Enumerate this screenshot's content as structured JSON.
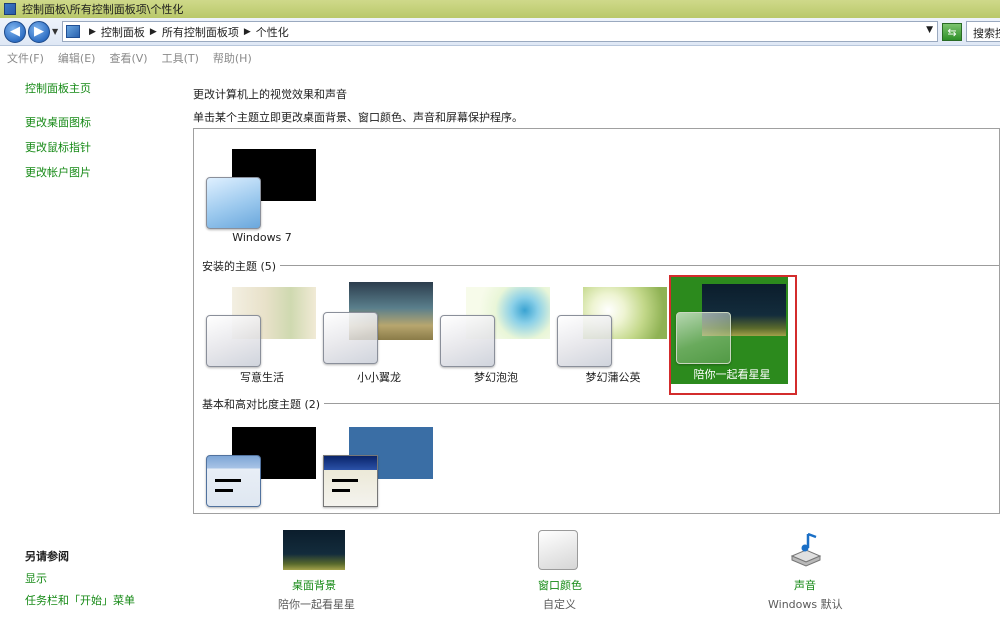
{
  "window": {
    "title": "控制面板\\所有控制面板项\\个性化"
  },
  "address": {
    "crumbs": [
      "控制面板",
      "所有控制面板项",
      "个性化"
    ],
    "search_placeholder": "搜索控制面板"
  },
  "menu": [
    "文件(F)",
    "编辑(E)",
    "查看(V)",
    "工具(T)",
    "帮助(H)"
  ],
  "sidebar": {
    "home": "控制面板主页",
    "links": [
      "更改桌面图标",
      "更改鼠标指针",
      "更改帐户图片"
    ],
    "see_also_title": "另请参阅",
    "see_also": [
      "显示",
      "任务栏和「开始」菜单"
    ]
  },
  "main": {
    "heading": "更改计算机上的视觉效果和声音",
    "subheading": "单击某个主题立即更改桌面背景、窗口颜色、声音和屏幕保护程序。",
    "aero_theme": {
      "label": "Windows 7"
    },
    "installed_group": "安装的主题 (5)",
    "installed": [
      {
        "label": "写意生活"
      },
      {
        "label": "小小翼龙"
      },
      {
        "label": "梦幻泡泡"
      },
      {
        "label": "梦幻蒲公英"
      },
      {
        "label": "陪你一起看星星"
      }
    ],
    "basic_group": "基本和高对比度主题 (2)"
  },
  "bottom": {
    "desktop_bg": {
      "title": "桌面背景",
      "value": "陪你一起看星星"
    },
    "window_color": {
      "title": "窗口颜色",
      "value": "自定义"
    },
    "sound": {
      "title": "声音",
      "value": "Windows 默认"
    }
  },
  "colors": {
    "link_green": "#168a16",
    "selected_bg": "#2c8a1d",
    "selection_border": "#d32c2c"
  },
  "icons": [
    "back-arrow-icon",
    "forward-arrow-icon",
    "control-panel-icon",
    "refresh-icon",
    "sound-note-icon"
  ]
}
